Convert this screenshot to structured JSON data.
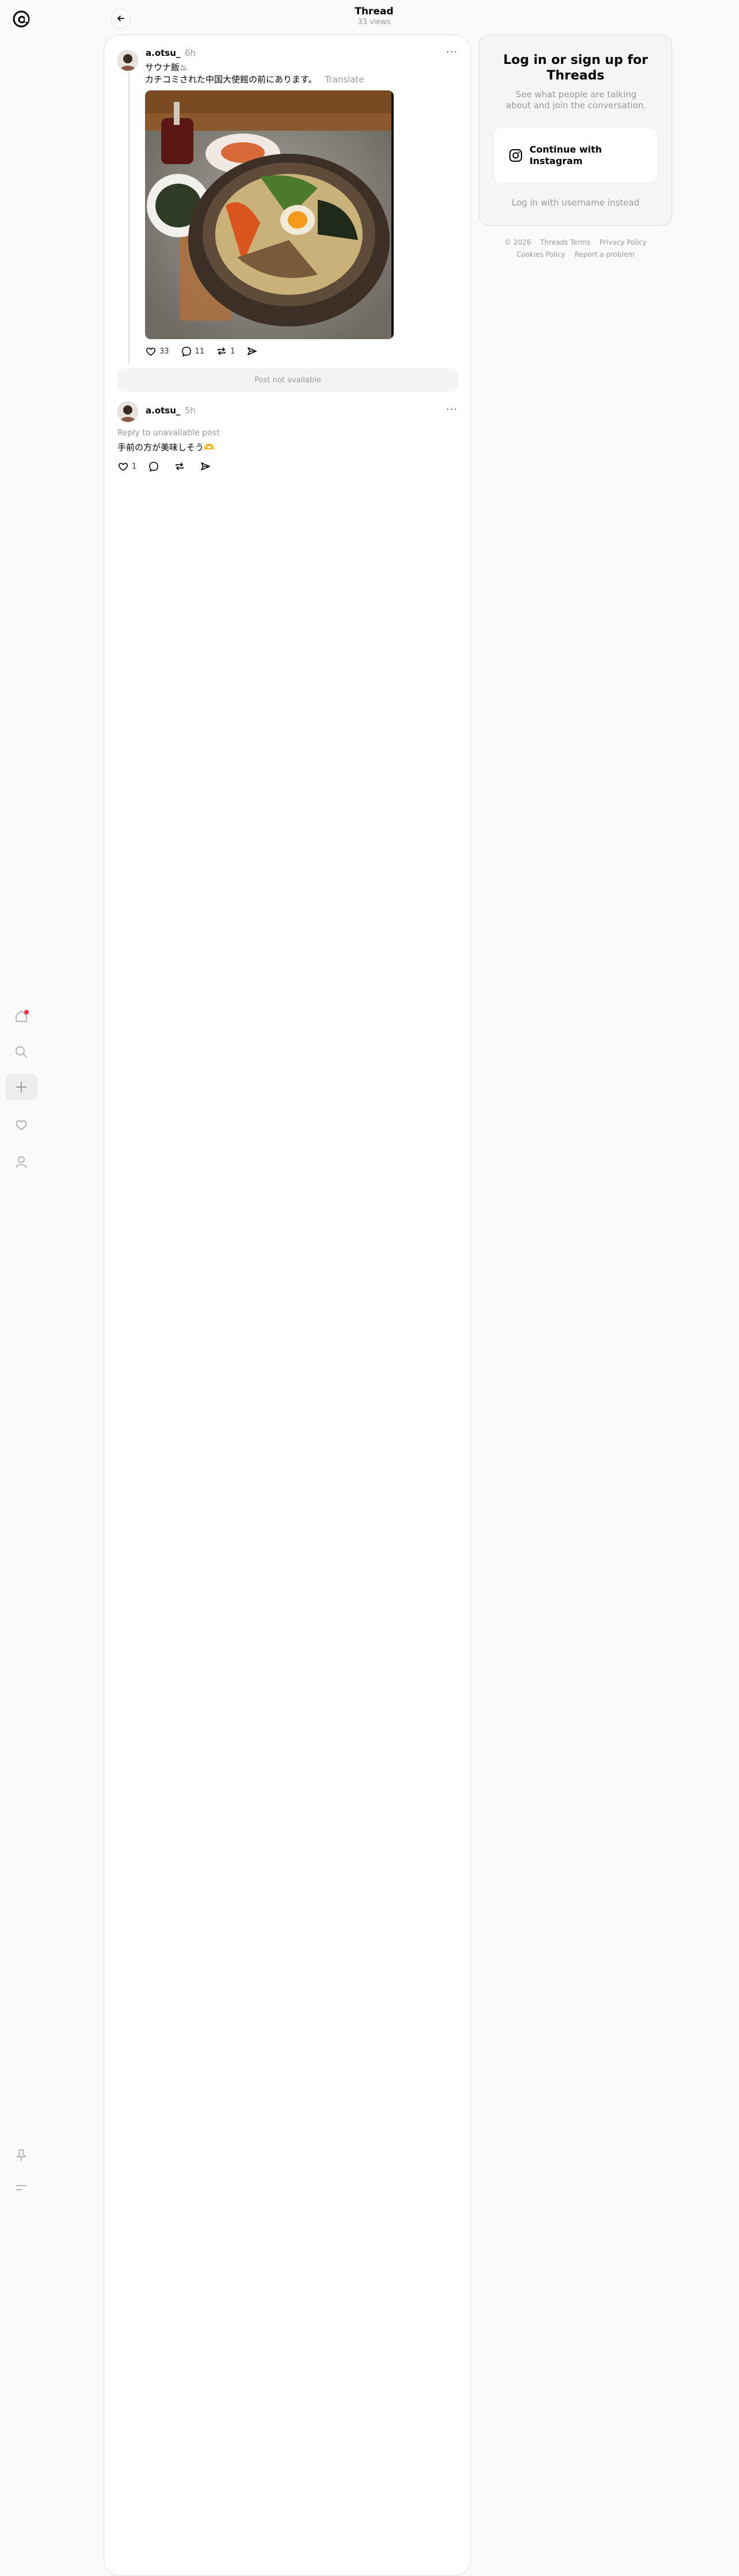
{
  "header": {
    "title": "Thread",
    "views": "33 views"
  },
  "post": {
    "username": "a.otsu_",
    "time": "6h",
    "line1": "サウナ飯♨︎",
    "line2": "カチコミされた中国大使館の前にあります。",
    "translate": "Translate",
    "likes": "33",
    "comments": "11",
    "reposts": "1"
  },
  "unavailable": "Post not available",
  "reply": {
    "username": "a.otsu_",
    "time": "5h",
    "reply_to": "Reply to unavailable post",
    "text": "手前の方が美味しそう🫶",
    "likes": "1"
  },
  "login": {
    "title": "Log in or sign up for Threads",
    "subtitle": "See what people are talking about and join the conversation.",
    "instagram_button": "Continue with Instagram",
    "username_link": "Log in with username instead"
  },
  "footer": {
    "copyright": "© 2026",
    "terms": "Threads Terms",
    "privacy": "Privacy Policy",
    "cookies": "Cookies Policy",
    "report": "Report a problem"
  },
  "colors": {
    "notification_dot": "#ff3040",
    "muted_text": "#999999"
  },
  "icons": [
    "threads-logo-icon",
    "home-icon",
    "search-icon",
    "create-icon",
    "activity-icon",
    "profile-icon",
    "pin-icon",
    "menu-icon",
    "back-arrow-icon",
    "more-icon",
    "heart-icon",
    "comment-icon",
    "repost-icon",
    "share-icon",
    "instagram-icon"
  ]
}
